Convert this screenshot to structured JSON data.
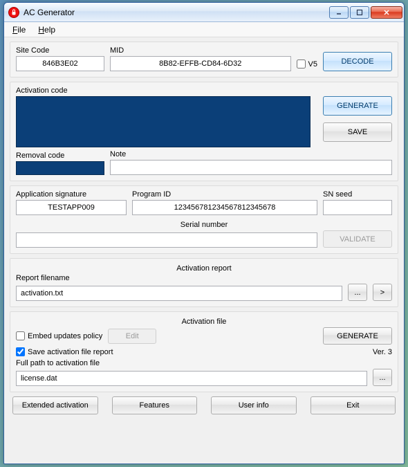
{
  "window": {
    "title": "AC Generator"
  },
  "menu": {
    "file": "File",
    "help": "Help"
  },
  "decode": {
    "site_code_label": "Site Code",
    "site_code": "846B3E02",
    "mid_label": "MID",
    "mid": "8B82-EFFB-CD84-6D32",
    "v5_label": "V5",
    "v5_checked": false,
    "decode_btn": "DECODE"
  },
  "activation": {
    "code_label": "Activation code",
    "code_value": "",
    "removal_label": "Removal code",
    "removal_value": "",
    "note_label": "Note",
    "note_value": "",
    "generate_btn": "GENERATE",
    "save_btn": "SAVE"
  },
  "signature": {
    "app_sig_label": "Application signature",
    "app_sig": "TESTAPP009",
    "program_id_label": "Program ID",
    "program_id": "123456781234567812345678",
    "sn_seed_label": "SN seed",
    "sn_seed": "",
    "serial_label": "Serial number",
    "serial_value": "",
    "validate_btn": "VALIDATE"
  },
  "report": {
    "section": "Activation report",
    "filename_label": "Report filename",
    "filename": "activation.txt",
    "browse": "...",
    "go": ">"
  },
  "file": {
    "section": "Activation file",
    "embed_label": "Embed updates policy",
    "embed_checked": false,
    "edit_btn": "Edit",
    "save_report_label": "Save activation file report",
    "save_report_checked": true,
    "generate_btn": "GENERATE",
    "version": "Ver. 3",
    "path_label": "Full path to activation file",
    "path": "license.dat",
    "browse": "..."
  },
  "bottom": {
    "extended": "Extended activation",
    "features": "Features",
    "userinfo": "User info",
    "exit": "Exit"
  }
}
